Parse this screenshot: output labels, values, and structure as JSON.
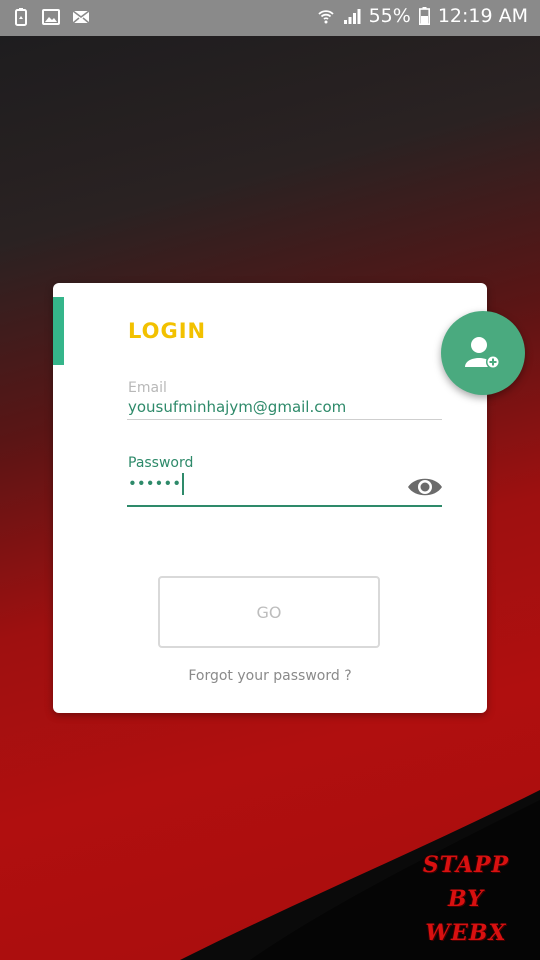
{
  "status_bar": {
    "battery_percent": "55%",
    "time": "12:19 AM",
    "icons": [
      "recycle-icon",
      "image-icon",
      "mail-icon",
      "wifi-icon",
      "signal-icon",
      "battery-icon"
    ]
  },
  "login": {
    "title": "LOGIN",
    "email_label": "Email",
    "email_value": "yousufminhajym@gmail.com",
    "password_label": "Password",
    "password_value": "••••••",
    "go_label": "GO",
    "forgot_label": "Forgot your password ?"
  },
  "watermark": {
    "line1": "STAPP",
    "line2": "BY",
    "line3": "WEBX"
  },
  "colors": {
    "accent_green": "#35b58a",
    "title_yellow": "#f2c100",
    "fab_green": "#4aaa7f",
    "background_red": "#b00f0f"
  }
}
